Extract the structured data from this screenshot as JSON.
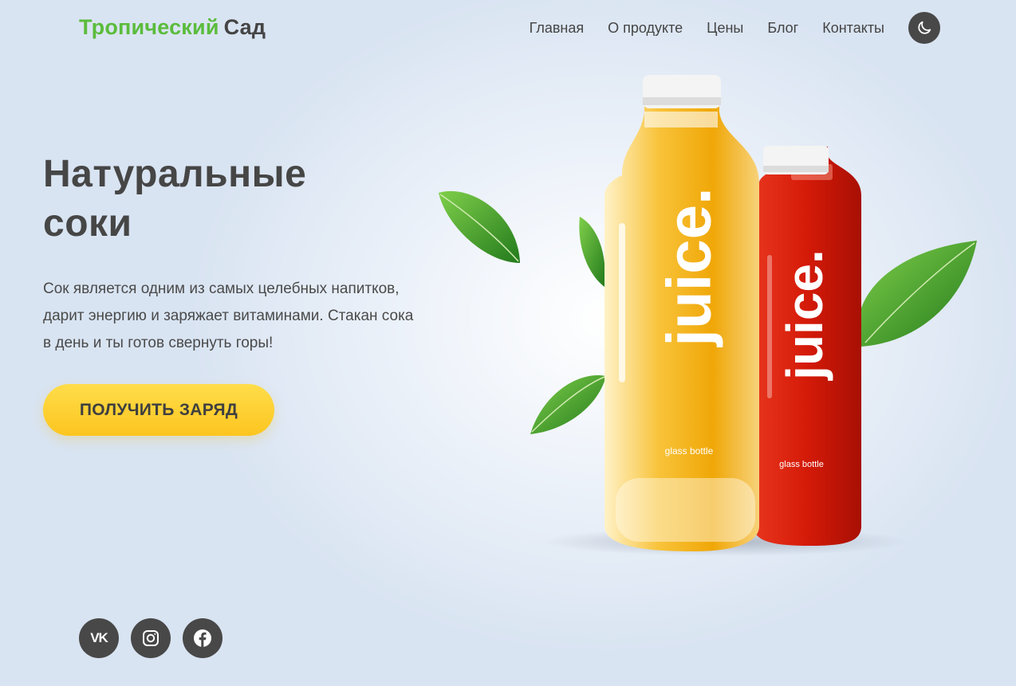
{
  "brand": {
    "part1": "Тропический",
    "part2": "Сад",
    "accent_color": "#5bbc3c"
  },
  "nav": {
    "items": [
      {
        "label": "Главная"
      },
      {
        "label": "О продукте"
      },
      {
        "label": "Цены"
      },
      {
        "label": "Блог"
      },
      {
        "label": "Контакты"
      }
    ],
    "theme_toggle_icon": "moon-icon"
  },
  "hero": {
    "title_line1": "Натуральные",
    "title_line2": "соки",
    "text_line1": "Сок является одним из самых целебных напитков,",
    "text_line2": "дарит энергию и заряжает витаминами. Стакан сока",
    "text_line3": "в день и ты готов свернуть горы!",
    "cta_label": "ПОЛУЧИТЬ ЗАРЯД",
    "cta_color": "#fcc51f"
  },
  "product": {
    "bottle1": {
      "brand": "juice.",
      "sub": "glass bottle",
      "color": "#f3a90c"
    },
    "bottle2": {
      "brand": "juice.",
      "sub": "glass bottle",
      "color": "#d81e0c"
    }
  },
  "socials": {
    "vk": {
      "icon": "vk-icon",
      "text": "VK"
    },
    "instagram": {
      "icon": "instagram-icon"
    },
    "facebook": {
      "icon": "facebook-icon"
    }
  }
}
